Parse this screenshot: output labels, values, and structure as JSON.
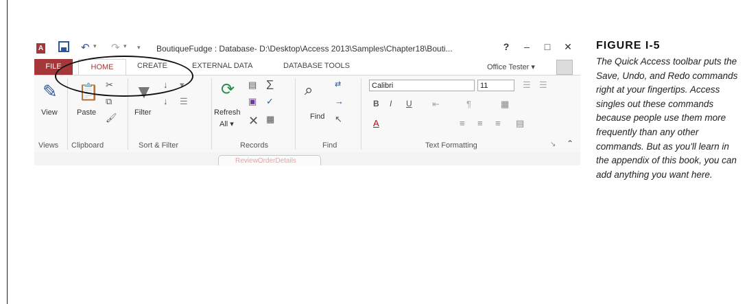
{
  "titlebar": {
    "app_icon_letter": "A",
    "title": "BoutiqueFudge : Database- D:\\Desktop\\Access 2013\\Samples\\Chapter18\\Bouti...",
    "help": "?",
    "minimize": "–",
    "maximize": "□",
    "close": "✕",
    "qat_customize": "▾"
  },
  "tabs": {
    "file": "FILE",
    "home": "HOME",
    "create": "CREATE",
    "external_data": "EXTERNAL DATA",
    "database_tools": "DATABASE TOOLS"
  },
  "user": {
    "name": "Office Tester ▾"
  },
  "ribbon": {
    "view_label": "View",
    "paste_label": "Paste",
    "filter_label": "Filter",
    "refresh_label": "Refresh",
    "refresh_all": "All ▾",
    "find_label": "Find",
    "font_name": "Calibri",
    "font_size": "11",
    "groups": {
      "views": "Views",
      "clipboard": "Clipboard",
      "sort_filter": "Sort & Filter",
      "records": "Records",
      "find": "Find",
      "text_formatting": "Text Formatting"
    }
  },
  "document_tab": {
    "label": "ReviewOrderDetails"
  },
  "caption": {
    "heading": "FIGURE I-5",
    "body": "The Quick Access toolbar puts the Save, Undo, and Redo commands right at your fingertips. Access singles out these commands because people use them more frequently than any other commands. But as you'll learn in the appendix of this book, you can add anything you want here."
  },
  "colors": {
    "accent": "#a4373a",
    "qat_blue": "#2b579a"
  }
}
